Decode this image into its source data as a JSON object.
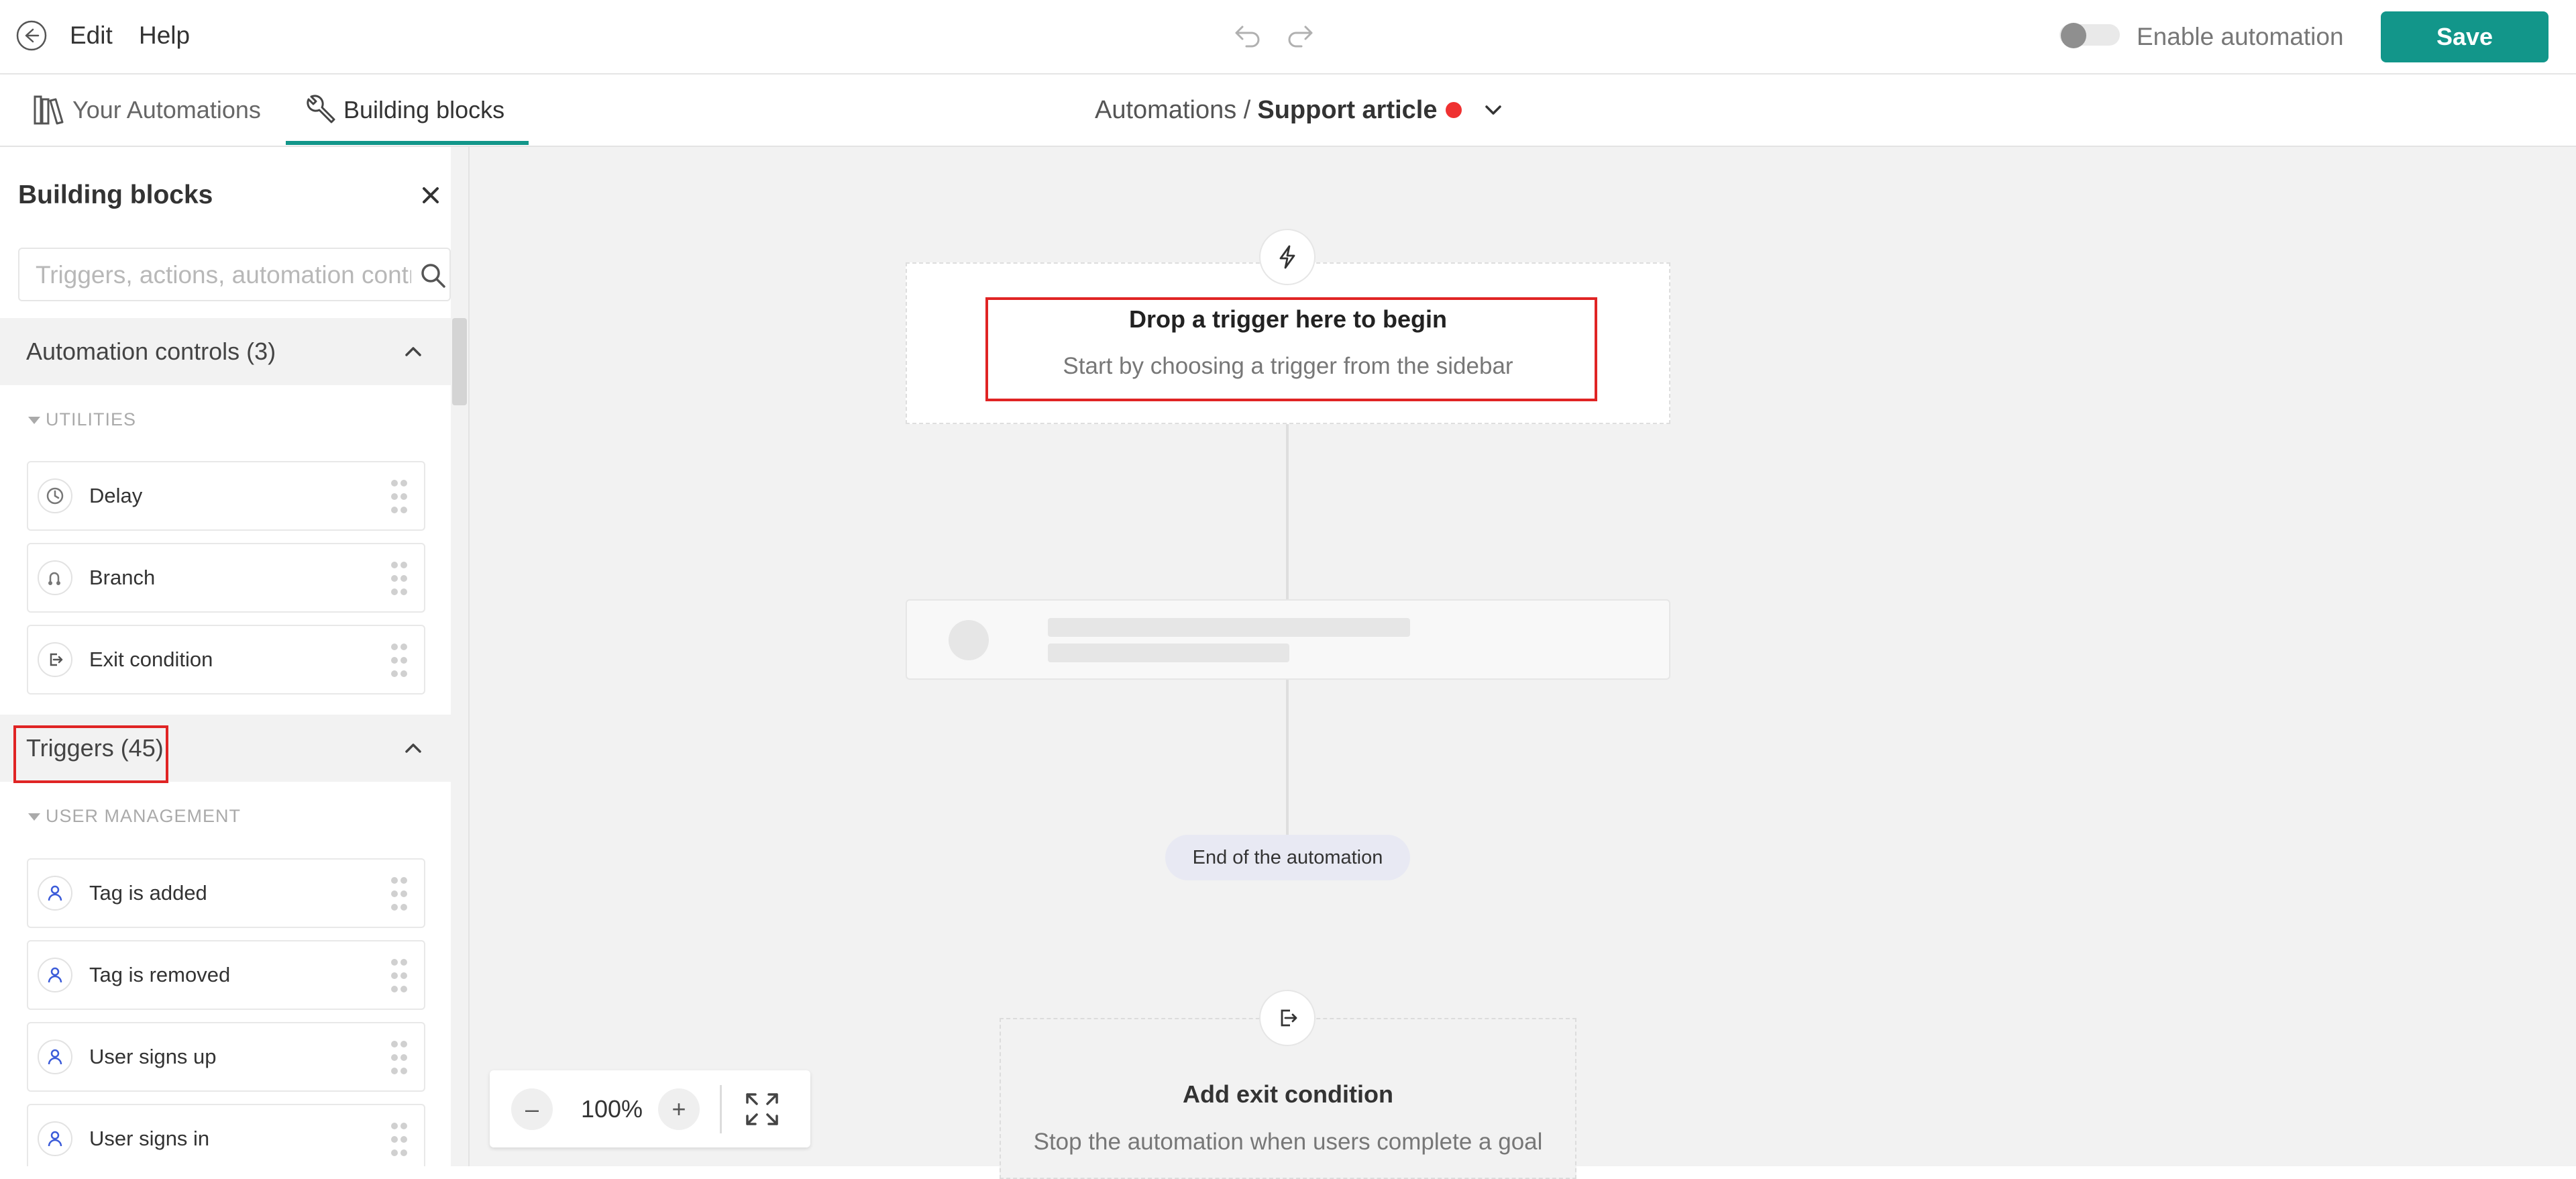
{
  "topbar": {
    "menu_edit": "Edit",
    "menu_help": "Help",
    "enable_label": "Enable automation",
    "enable_state": "off",
    "save_label": "Save",
    "icons": [
      "back-circle-icon",
      "undo-icon",
      "redo-icon"
    ]
  },
  "tabs": [
    {
      "label": "Your Automations",
      "icon": "books-icon",
      "active": false
    },
    {
      "label": "Building blocks",
      "icon": "wrench-icon",
      "active": true
    }
  ],
  "breadcrumb": {
    "parent": "Automations /",
    "current": "Support article",
    "status_color": "#ef3131"
  },
  "sidebar": {
    "title": "Building blocks",
    "search_placeholder": "Triggers, actions, automation controls",
    "sections": [
      {
        "label": "Automation controls (3)",
        "expanded": true,
        "group": "UTILITIES",
        "items": [
          {
            "label": "Delay",
            "icon": "clock-icon"
          },
          {
            "label": "Branch",
            "icon": "branch-icon"
          },
          {
            "label": "Exit condition",
            "icon": "exit-icon"
          }
        ]
      },
      {
        "label": "Triggers (45)",
        "expanded": true,
        "group": "USER MANAGEMENT",
        "items": [
          {
            "label": "Tag is added",
            "icon": "user-icon"
          },
          {
            "label": "Tag is removed",
            "icon": "user-icon"
          },
          {
            "label": "User signs up",
            "icon": "user-icon"
          },
          {
            "label": "User signs in",
            "icon": "user-icon"
          }
        ]
      }
    ]
  },
  "canvas": {
    "trigger_title": "Drop a trigger here to begin",
    "trigger_subtitle": "Start by choosing a trigger from the sidebar",
    "end_label": "End of the automation",
    "exit_title": "Add exit condition",
    "exit_subtitle": "Stop the automation when users complete a goal"
  },
  "zoom": {
    "value": "100%",
    "minus": "–",
    "plus": "+"
  },
  "colors": {
    "accent": "#12968a",
    "highlight": "#e02424",
    "status_dot": "#ef3131"
  }
}
